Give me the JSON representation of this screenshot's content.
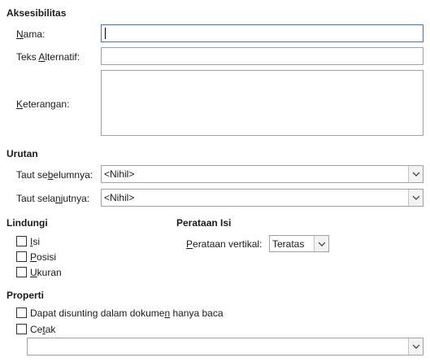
{
  "accessibility": {
    "title": "Aksesibilitas",
    "name_label": {
      "pre": "",
      "u": "N",
      "post": "ama:"
    },
    "name_value": "",
    "alt_text_label": {
      "pre": "Teks ",
      "u": "A",
      "post": "lternatif:"
    },
    "alt_text_value": "",
    "description_label": {
      "pre": "",
      "u": "K",
      "post": "eterangan:"
    },
    "description_value": ""
  },
  "sequence": {
    "title": "Urutan",
    "prev_label": {
      "pre": "Taut se",
      "u": "b",
      "post": "elumnya:"
    },
    "prev_value": "<Nihil>",
    "next_label": {
      "pre": "Taut sela",
      "u": "n",
      "post": "jutnya:"
    },
    "next_value": "<Nihil>"
  },
  "protect": {
    "title": "Lindungi",
    "items": [
      {
        "pre": "",
        "u": "I",
        "post": "si",
        "checked": false
      },
      {
        "pre": "",
        "u": "P",
        "post": "osisi",
        "checked": false
      },
      {
        "pre": "",
        "u": "U",
        "post": "kuran",
        "checked": false
      }
    ]
  },
  "content_alignment": {
    "title": "Perataan Isi",
    "vertical_label": {
      "pre": "",
      "u": "P",
      "post": "erataan vertikal:"
    },
    "vertical_value": "Teratas"
  },
  "properties": {
    "title": "Properti",
    "editable_readonly": {
      "pre": "Dapat disunting dalam dokume",
      "u": "n",
      "post": " hanya baca",
      "checked": false
    },
    "print": {
      "pre": "Ce",
      "u": "t",
      "post": "ak",
      "checked": false
    },
    "text_direction_value": ""
  },
  "icons": {
    "dropdown": "chevron-down-icon"
  }
}
